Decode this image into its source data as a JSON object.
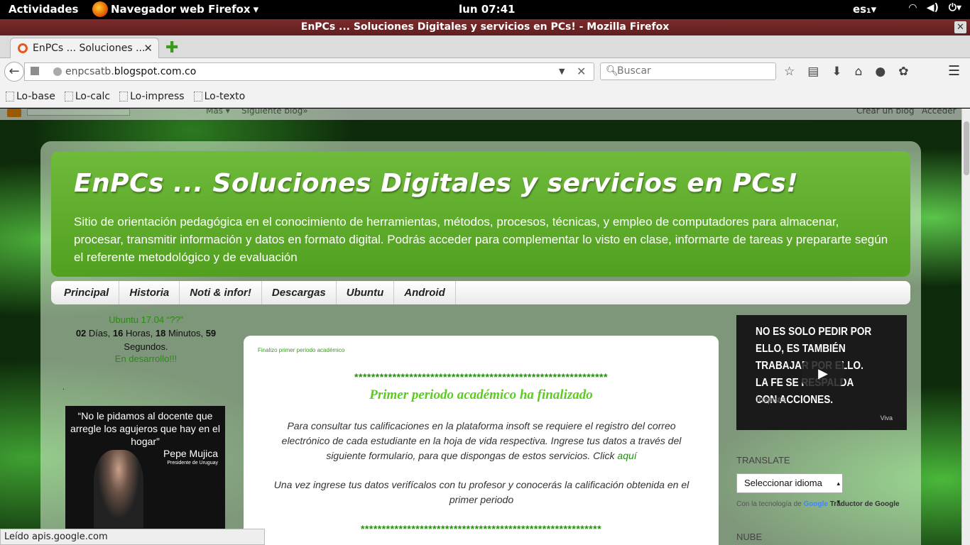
{
  "system": {
    "activities": "Actividades",
    "app_name": "Navegador web Firefox",
    "clock": "lun 07:41",
    "lang": "es₁"
  },
  "window": {
    "title": "EnPCs ... Soluciones Digitales y servicios en PCs! - Mozilla Firefox"
  },
  "tab": {
    "label": "EnPCs ... Soluciones ..."
  },
  "navbar": {
    "url_prefix": "enpcsatb.",
    "url_domain": "blogspot.com.co",
    "search_placeholder": "Buscar"
  },
  "bookmarks": [
    "Lo-base",
    "Lo-calc",
    "Lo-impress",
    "Lo-texto"
  ],
  "blogger_bar": {
    "mas": "Más ▾",
    "siguiente": "Siguiente blog»",
    "crear": "Crear un blog",
    "acceder": "Acceder"
  },
  "blog": {
    "title": "EnPCs ... Soluciones Digitales y servicios en PCs!",
    "description": "Sitio de orientación pedagógica en el conocimiento de herramientas, métodos, procesos, técnicas, y empleo de computadores para almacenar, procesar, transmitir información y datos en formato digital. Podrás acceder para complementar lo visto en clase, informarte de tareas y prepararte según el referente metodológico y de evaluación",
    "tabs": [
      "Principal",
      "Historia",
      "Noti & infor!",
      "Descargas",
      "Ubuntu",
      "Android"
    ]
  },
  "sidebar_left": {
    "ubuntu": "Ubuntu 17.04 “??”",
    "days": "02",
    "days_lbl": " Días, ",
    "hours": "16",
    "hours_lbl": " Horas, ",
    "minutes": "18",
    "minutes_lbl": " Minutos, ",
    "seconds": "59",
    "seconds_lbl": " Segundos.",
    "dev": "En desarrollo!!!",
    "dot": ".",
    "quote": "“No le pidamos al docente que arregle los agujeros que hay en el hogar”",
    "quote_author": "Pepe Mujica",
    "quote_role": "Presidente de Uruguay"
  },
  "post": {
    "crumb": "Finalizo primer periodo académico",
    "stars": "************************************************************",
    "title": "Primer periodo académico ha finalizado",
    "body1": "Para consultar tus calificaciones en la plataforma insoft se requiere el registro del correo electrónico de cada estudiante en la hoja de vida respectiva. Ingrese tus datos a través del siguiente formulario, para que dispongas de estos servicios.  Click ",
    "link": "aquí",
    "body2": "Una vez ingrese tus datos verifícalos con tu profesor y conocerás la calificación obtenida en el primer periodo",
    "stars2": "*********************************************************"
  },
  "sidebar_right": {
    "video_text": "NO ES SOLO PEDIR POR ELLO, ES TAMBIÉN TRABAJAR POR ELLO. LA FE SE RESPALDA CON ACCIONES.",
    "video_brand": "Inspiras",
    "video_logo": "Viva",
    "translate_heading": "TRANSLATE",
    "select_value": "Seleccionar idioma",
    "powered_by": "Con la tecnología de ",
    "google": "Google",
    "traductor": " Traductor de Google",
    "nube": "NUBE"
  },
  "status": "Leído apis.google.com"
}
